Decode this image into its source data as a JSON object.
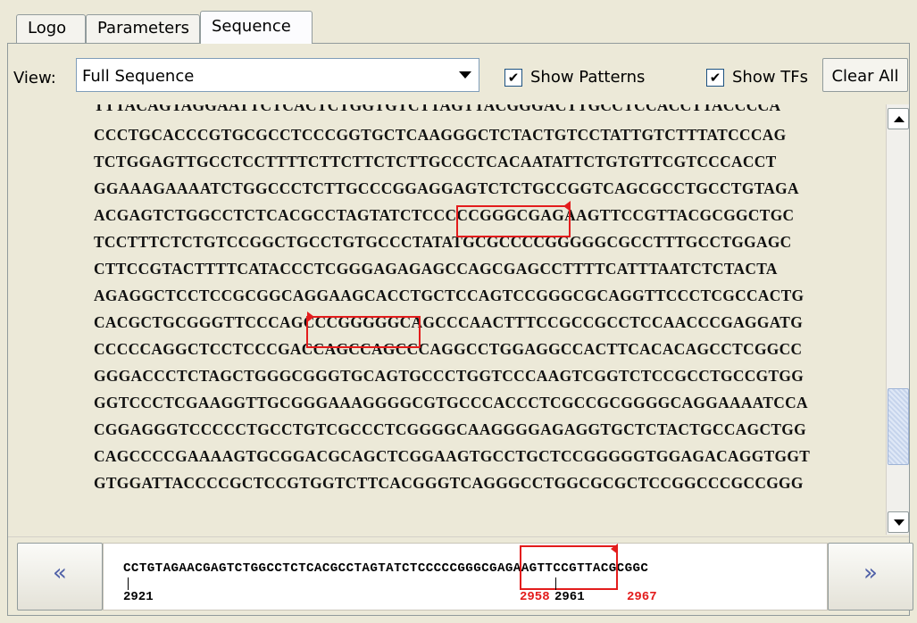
{
  "tabs": [
    {
      "label": "Logo"
    },
    {
      "label": "Parameters"
    },
    {
      "label": "Sequence",
      "active": true
    }
  ],
  "toolbar": {
    "view_label": "View:",
    "view_value": "Full Sequence",
    "show_patterns_label": "Show Patterns",
    "show_patterns_checked": true,
    "show_tfs_label": "Show TFs",
    "show_tfs_checked": true,
    "clear_label": "Clear All"
  },
  "sequence": {
    "partial_top": "TTTACAGTAGGAATTCTCACTCTGGTGTCTTAGTTACGGGACTTGCCTCCACCTTACCCCA",
    "lines": [
      "CCCTGCACCCGTGCGCCTCCCGGTGCTCAAGGGCTCTACTGTCCTATTGTCTTTATCCCAG",
      "TCTGGAGTTGCCTCCTTTTCTTCTTCTCTTGCCCTCACAATATTCTGTGTTCGTCCCACCT",
      "GGAAAGAAAATCTGGCCCTCTTGCCCGGAGGAGTCTCTGCCGGTCAGCGCCTGCCTGTAGA",
      "ACGAGTCTGGCCTCTCACGCCTAGTATCTCCCCCGGGCGAGAAGTTCCGTTACGCGGCTGC",
      "TCCTTTCTCTGTCCGGCTGCCTGTGCCCTATATGCGCCCCGGGGGCGCCTTTGCCTGGAGC",
      "CTTCCGTACTTTTCATACCCTCGGGAGAGAGCCAGCGAGCCTTTTCATTTAATCTCTACTA",
      "AGAGGCTCCTCCGCGGCAGGAAGCACCTGCTCCAGTCCGGGCGCAGGTTCCCTCGCCACTG",
      "CACGCTGCGGGTTCCCAGCCCGGGGGCAGCCCAACTTTCCGCCGCCTCCAACCCGAGGATG",
      "CCCCCAGGCTCCTCCCGACCAGCCAGCCCAGGCCTGGAGGCCACTTCACACAGCCTCGGCC",
      "GGGACCCTCTAGCTGGGCGGGTGCAGTGCCCTGGTCCCAAGTCGGTCTCCGCCTGCCGTGG",
      "GGTCCCTCGAAGGTTGCGGGAAAGGGGCGTGCCCACCCTCGCCGCGGGGCAGGAAAATCCA",
      "CGGAGGGTCCCCCTGCCTGTCGCCCTCGGGGCAAGGGGAGAGGTGCTCTACTGCCAGCTGG",
      "CAGCCCCGAAAAGTGCGGACGCAGCTCGGAAGTGCCTGCTCCGGGGGTGGAGACAGGTGGT",
      "GTGGATTACCCCGCTCCGTGGTCTTCACGGGTCAGGGCCTGGCGCGCTCCGGCCCGCCGGG"
    ],
    "pattern_color": "#e31c1c"
  },
  "bottom": {
    "prev_icon": "double-chevron-left-icon",
    "next_icon": "double-chevron-right-icon",
    "prev_glyph": "«",
    "next_glyph": "»",
    "mini_sequence": "CCTGTAGAACGAGTCTGGCCTCTCACGCCTAGTATCTCCCCCGGGCGAGAAGTTCCGTTACGCGGC",
    "start_position": "2921",
    "pattern_start": "2958",
    "mid_position": "2961",
    "pattern_end": "2967"
  }
}
